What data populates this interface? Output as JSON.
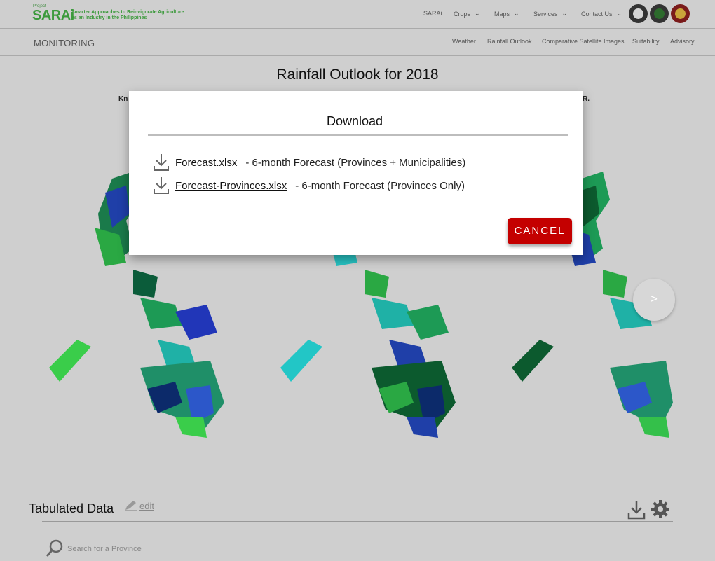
{
  "header": {
    "logo_small": "Project",
    "logo_name": "SARAi",
    "logo_tagline": "Smarter Approaches to Reinvigorate Agriculture as an Industry in the Philippines",
    "nav": [
      {
        "label": "SARAi",
        "dropdown": false
      },
      {
        "label": "Crops",
        "dropdown": true
      },
      {
        "label": "Maps",
        "dropdown": true
      },
      {
        "label": "Services",
        "dropdown": true
      },
      {
        "label": "Contact Us",
        "dropdown": true
      }
    ]
  },
  "subnav": {
    "section": "MONITORING",
    "links": [
      "Weather",
      "Rainfall Outlook",
      "Comparative Satellite Images",
      "Suitability",
      "Advisory"
    ]
  },
  "main": {
    "title": "Rainfall Outlook for 2018",
    "intro_left": "Kn",
    "intro_right": "R.",
    "next_label": ">"
  },
  "tabulated": {
    "title": "Tabulated Data",
    "edit_label": "edit",
    "search_placeholder": "Search for a Province"
  },
  "modal": {
    "title": "Download",
    "files": [
      {
        "name": "Forecast.xlsx",
        "desc": "- 6-month Forecast (Provinces + Municipalities)"
      },
      {
        "name": "Forecast-Provinces.xlsx",
        "desc": "- 6-month Forecast (Provinces Only)"
      }
    ],
    "cancel_label": "CANCEL"
  },
  "colors": {
    "accent_red": "#c40000",
    "brand_green": "#3c9a3c",
    "overlay_bg": "#cfcfcf"
  }
}
